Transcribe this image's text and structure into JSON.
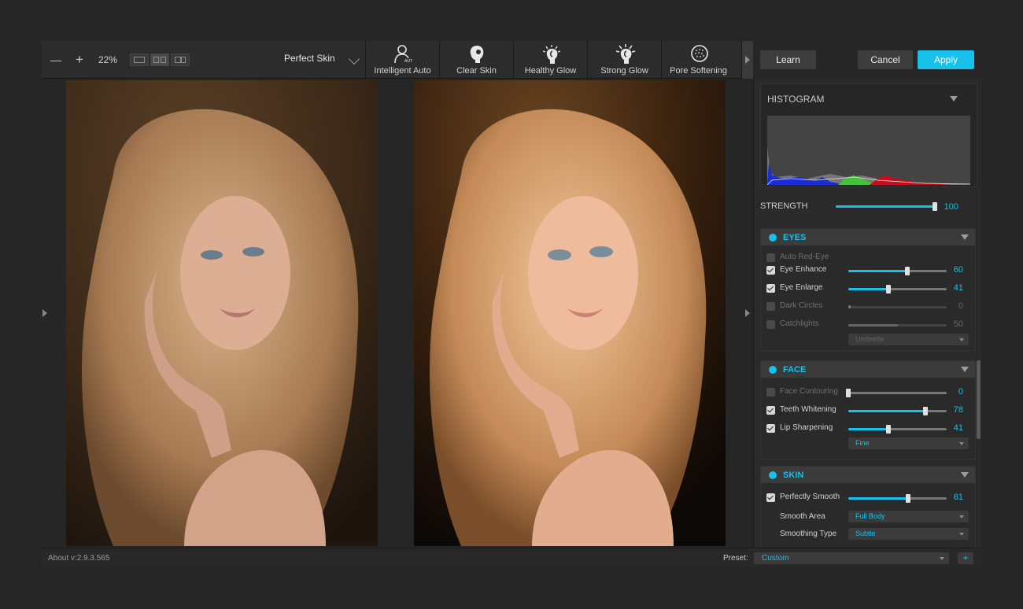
{
  "toolbar": {
    "zoom_out": "—",
    "zoom_in": "+",
    "zoom_level": "22%",
    "preset_name": "Perfect Skin",
    "presets": [
      "Intelligent Auto",
      "Clear Skin",
      "Healthy Glow",
      "Strong Glow",
      "Pore Softening"
    ]
  },
  "header": {
    "learn": "Learn",
    "cancel": "Cancel",
    "apply": "Apply"
  },
  "histogram": {
    "title": "HISTOGRAM"
  },
  "strength": {
    "label": "STRENGTH",
    "value": "100",
    "level": 100
  },
  "eyes": {
    "title": "EYES",
    "rows": [
      {
        "label": "Auto Red-Eye",
        "checked": false,
        "enabled": false
      },
      {
        "label": "Eye Enhance",
        "value": "60",
        "level": 60,
        "checked": true
      },
      {
        "label": "Eye Enlarge",
        "value": "41",
        "level": 41,
        "checked": true
      },
      {
        "label": "Dark Circles",
        "value": "0",
        "level": 0,
        "checked": false
      },
      {
        "label": "Catchlights",
        "value": "50",
        "level": 50,
        "checked": false
      }
    ],
    "catchlight_type": "Umbrella"
  },
  "face": {
    "title": "FACE",
    "rows": [
      {
        "label": "Face Contouring",
        "value": "0",
        "level": 0,
        "checked": false
      },
      {
        "label": "Teeth Whitening",
        "value": "78",
        "level": 78,
        "checked": true
      },
      {
        "label": "Lip Sharpening",
        "value": "41",
        "level": 41,
        "checked": true
      }
    ],
    "sharpen_type": "Fine"
  },
  "skin": {
    "title": "SKIN",
    "smooth_label": "Perfectly Smooth",
    "smooth_value": "61",
    "smooth_level": 61,
    "area_label": "Smooth Area",
    "area_value": "Full Body",
    "type_label": "Smoothing Type",
    "type_value": "Subtle"
  },
  "footer": {
    "about": "About v:2.9.3.565",
    "preset_label": "Preset:",
    "preset_value": "Custom",
    "add": "+"
  },
  "colors": {
    "accent": "#17c1ec",
    "background": "#202020",
    "panel": "#2a2a2a"
  }
}
